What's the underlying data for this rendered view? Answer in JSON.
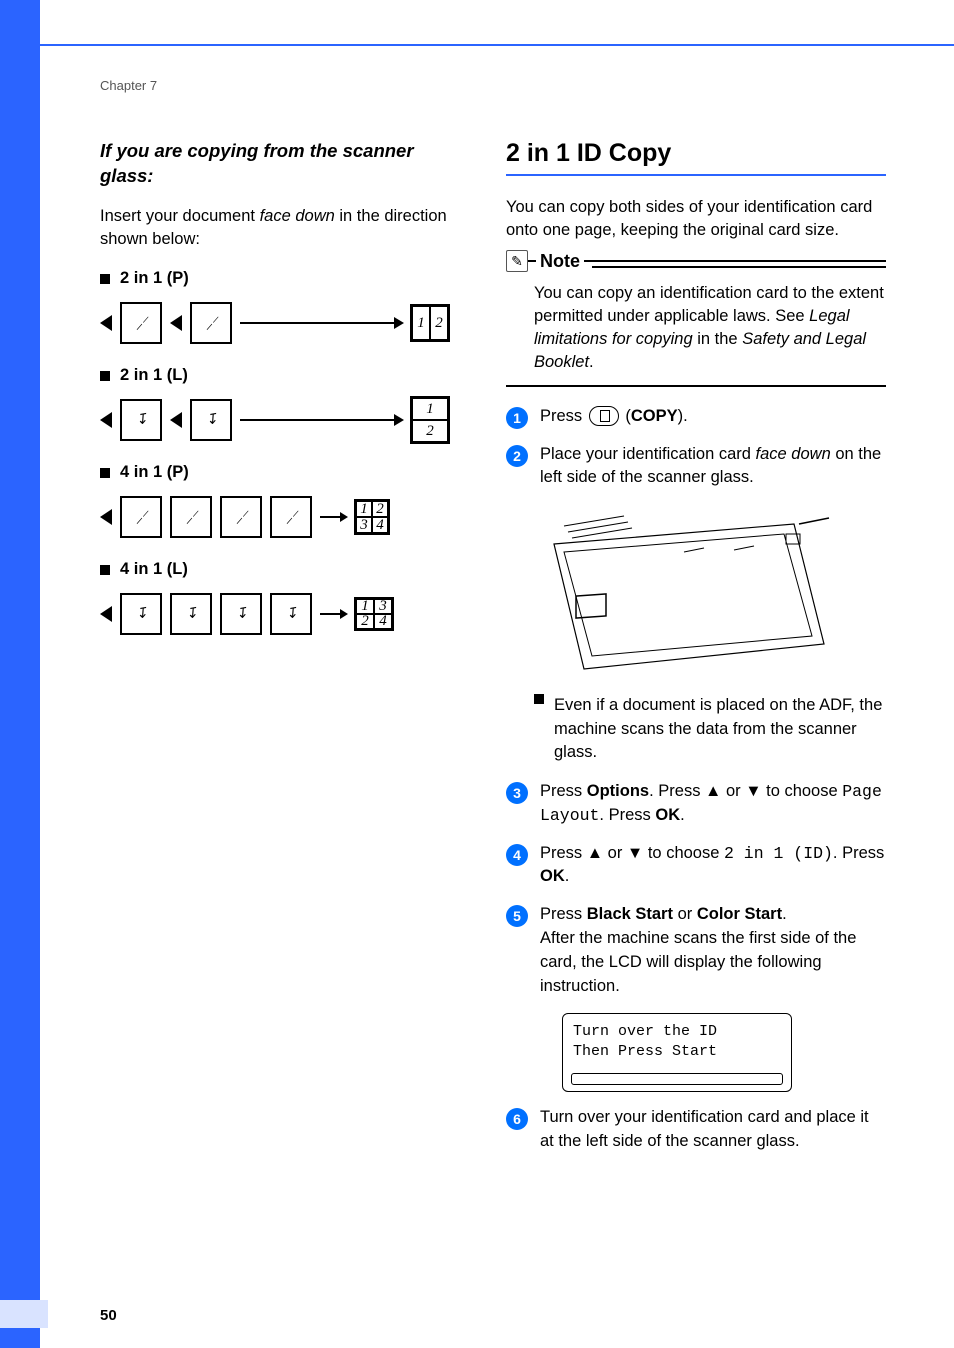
{
  "chapter_label": "Chapter 7",
  "page_number": "50",
  "left": {
    "heading": "If you are copying from the scanner glass:",
    "intro_pre": "Insert your document ",
    "intro_ital": "face down",
    "intro_post": " in the direction shown below:",
    "items": [
      {
        "label": "2 in 1 (P)"
      },
      {
        "label": "2 in 1 (L)"
      },
      {
        "label": "4 in 1 (P)"
      },
      {
        "label": "4 in 1 (L)"
      }
    ]
  },
  "right": {
    "heading": "2 in 1 ID Copy",
    "intro": "You can copy both sides of your identification card onto one page, keeping the original card size.",
    "note_title": "Note",
    "note_text_1": "You can copy an identification card to the extent permitted under applicable laws. See ",
    "note_text_ital": "Legal limitations for copying",
    "note_text_2": " in the ",
    "note_text_ital2": "Safety and Legal Booklet",
    "note_text_3": ".",
    "steps": {
      "s1_pre": "Press ",
      "s1_post": " (",
      "s1_bold": "COPY",
      "s1_end": ").",
      "s2_pre": "Place your identification card ",
      "s2_ital": "face down",
      "s2_post": " on the left side of the scanner glass.",
      "s2_bullet": "Even if a document is placed on the ADF, the machine scans the data from the scanner glass.",
      "s3_a": "Press ",
      "s3_b": "Options",
      "s3_c": ". Press ▲ or ▼ to choose ",
      "s3_mono": "Page Layout",
      "s3_d": ". Press ",
      "s3_e": "OK",
      "s3_f": ".",
      "s4_a": "Press ▲ or ▼ to choose ",
      "s4_mono": "2 in 1 (ID)",
      "s4_b": ". Press ",
      "s4_c": "OK",
      "s4_d": ".",
      "s5_a": "Press ",
      "s5_b": "Black Start",
      "s5_c": " or ",
      "s5_d": "Color Start",
      "s5_e": ".",
      "s5_f": "After the machine scans the first side of the card, the LCD will display the following instruction.",
      "lcd_line1": "Turn over the ID",
      "lcd_line2": "Then Press Start",
      "s6": "Turn over your identification card and place it at the left side of the scanner glass."
    }
  }
}
